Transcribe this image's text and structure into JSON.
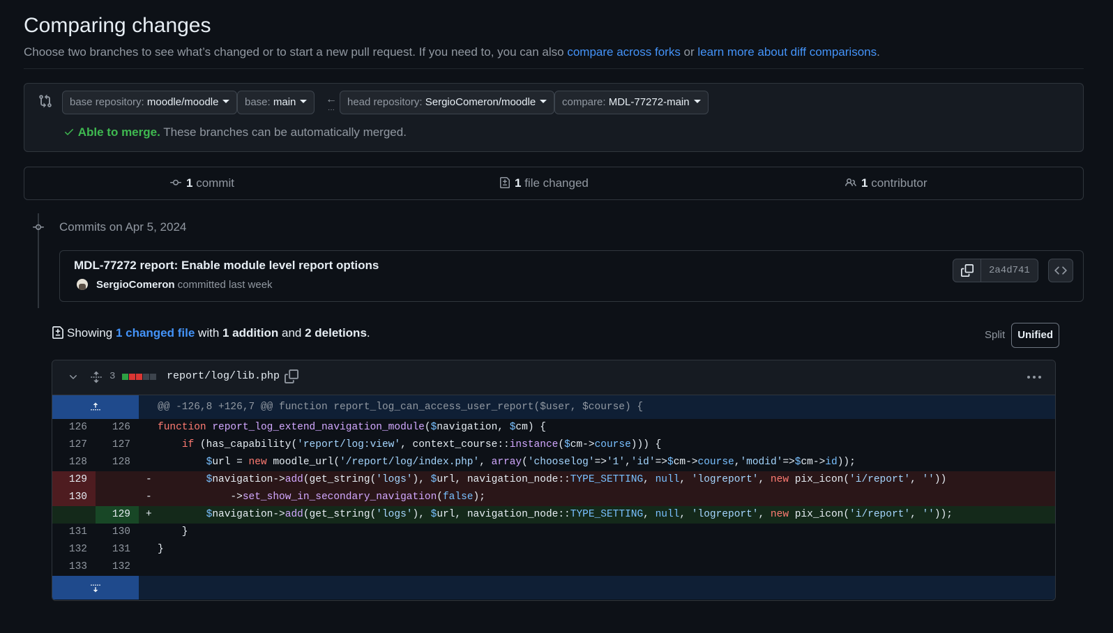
{
  "page": {
    "title": "Comparing changes",
    "subtitle_text": "Choose two branches to see what’s changed or to start a new pull request. If you need to, you can also ",
    "link_forks": "compare across forks",
    "subtitle_or": " or ",
    "link_learn": "learn more about diff comparisons",
    "subtitle_end": "."
  },
  "range": {
    "base_repo_label": "base repository:",
    "base_repo_value": "moodle/moodle",
    "base_label": "base:",
    "base_value": "main",
    "arrow": "←",
    "head_repo_label": "head repository:",
    "head_repo_value": "SergioComeron/moodle",
    "compare_label": "compare:",
    "compare_value": "MDL-77272-main",
    "merge_ok": "Able to merge.",
    "merge_desc": " These branches can be automatically merged."
  },
  "stats": {
    "commits_count": "1",
    "commits_label": " commit",
    "files_count": "1",
    "files_label": " file changed",
    "contributors_count": "1",
    "contributors_label": " contributor"
  },
  "commits": {
    "group_label": "Commits on Apr 5, 2024",
    "title": "MDL-77272 report: Enable module level report options",
    "author": "SergioComeron",
    "meta": " committed last week",
    "sha": "2a4d741"
  },
  "summary": {
    "showing": "Showing ",
    "changed_link": "1 changed file",
    "with": " with ",
    "additions": "1 addition",
    "and": " and ",
    "deletions": "2 deletions",
    "end": "."
  },
  "view_toggle": {
    "split": "Split",
    "unified": "Unified",
    "selected": "Unified"
  },
  "file": {
    "changes": "3",
    "path": "report/log/lib.php",
    "diffstat": [
      "add",
      "del",
      "del",
      "neutral",
      "neutral"
    ],
    "hunk_header": "@@ -126,8 +126,7 @@ function report_log_can_access_user_report($user, $course) {"
  },
  "colors": {
    "background": "#0d1117",
    "link": "#4493f8",
    "success": "#3fb950",
    "addition": "#2ea043",
    "deletion": "#da3633"
  }
}
